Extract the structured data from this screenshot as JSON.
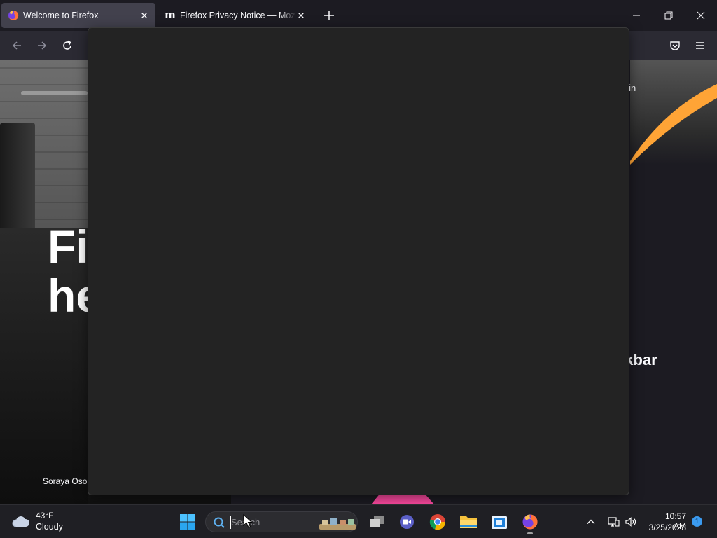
{
  "browser": {
    "tabs": [
      {
        "title": "Welcome to Firefox",
        "active": true,
        "favicon": "firefox-icon"
      },
      {
        "title": "Firefox Privacy Notice — Mozilla",
        "active": false,
        "favicon": "mozilla-m-icon",
        "favicon_glyph": "m"
      }
    ],
    "new_tab_icon": "plus-icon",
    "window_controls": [
      "minimize-icon",
      "restore-icon",
      "close-icon"
    ],
    "toolbar": {
      "back_icon": "back-arrow-icon",
      "forward_icon": "forward-arrow-icon",
      "reload_icon": "reload-icon",
      "pocket_icon": "pocket-icon",
      "menu_icon": "hamburger-menu-icon"
    }
  },
  "page": {
    "headline_line1": "Fi",
    "headline_line2": "he",
    "sign_in_fragment": "gn in",
    "taskbar_fragment": "skbar",
    "photo_credit": "Soraya Osor"
  },
  "colors": {
    "accent_orange": "#ffa436",
    "accent_pink": "#ff4aa2",
    "page_background": "#1c1b22",
    "overlay_background": "#232323"
  },
  "taskbar": {
    "weather": {
      "temperature": "43°F",
      "condition": "Cloudy",
      "icon": "cloud-icon"
    },
    "start_icon": "windows-start-icon",
    "search_placeholder": "Search",
    "pinned_apps": [
      "task-view-icon",
      "teams-chat-icon",
      "chrome-icon",
      "file-explorer-icon",
      "store-icon",
      "firefox-icon"
    ],
    "tray_icons": [
      "chevron-up-icon",
      "network-icon",
      "volume-icon"
    ],
    "time": "10:57 AM",
    "date": "3/25/2023",
    "notification_count": "1"
  }
}
